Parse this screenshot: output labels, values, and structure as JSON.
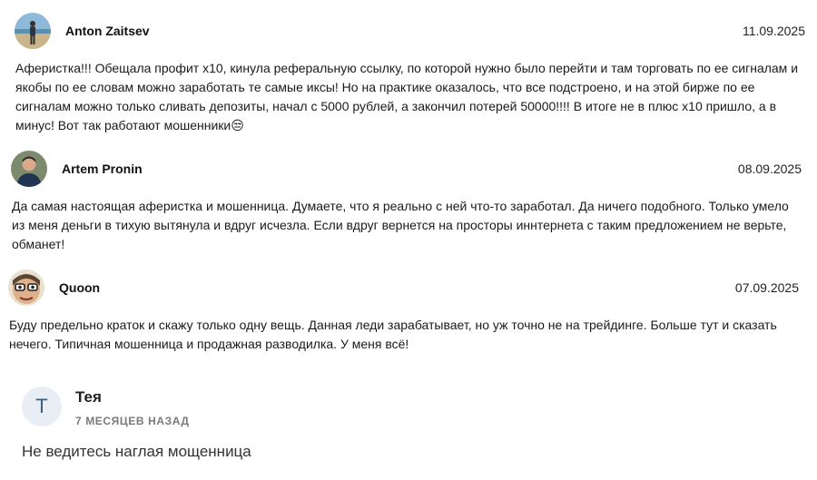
{
  "reviews": [
    {
      "author": "Anton Zaitsev",
      "date": "11.09.2025",
      "avatar": "beach-photo-avatar",
      "text": "Аферистка!!! Обещала профит х10, кинула реферальную ссылку, по которой нужно было перейти и там торговать по ее сигналам и якобы по ее словам можно заработать те самые иксы! Но на практике оказалось, что все подстроено, и на этой бирже по ее сигналам можно только сливать депозиты, начал с 5000 рублей, а закончил потерей 50000!!!! В итоге не в плюс х10 пришло, а в минус! Вот так работают мошенники😒"
    },
    {
      "author": "Artem Pronin",
      "date": "08.09.2025",
      "avatar": "portrait-photo-avatar",
      "text": "Да самая настоящая аферистка и мошенница. Думаете, что я реально с ней что-то заработал. Да ничего подобного. Только умело из меня деньги в тихую вытянула и вдруг исчезла. Если вдруг вернется на просторы иннтернета с таким предложением не верьте, обманет!"
    },
    {
      "author": "Quoon",
      "date": "07.09.2025",
      "avatar": "cartoon-face-avatar",
      "text": "Буду предельно краток и скажу только одну вещь. Данная леди зарабатывает, но уж точно не на трейдинге. Больше тут и сказать нечего. Типичная мошенница и продажная разводилка. У меня всё!"
    }
  ],
  "comment": {
    "initial": "Т",
    "author": "Тея",
    "time": "7 МЕСЯЦЕВ НАЗАД",
    "text": "Не ведитесь наглая мощенница"
  },
  "colors": {
    "comment_avatar_bg": "#e8eef4",
    "comment_avatar_fg": "#3d5f80",
    "meta_gray": "#7a7a7a"
  }
}
